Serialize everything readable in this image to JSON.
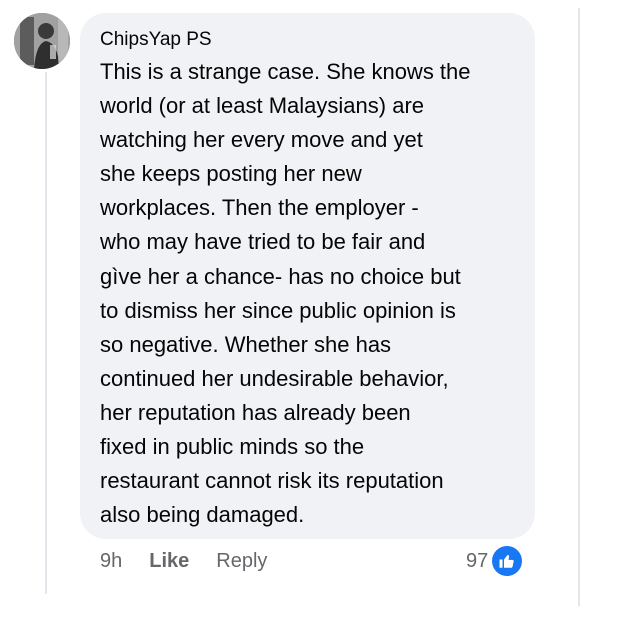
{
  "comment": {
    "author": "ChipsYap PS",
    "lines": [
      "This is a strange case. She knows the",
      "world (or at least Malaysians) are",
      "watching her every move and yet",
      "she keeps posting her new",
      "workplaces. Then the employer -",
      "who may have tried to be fair and",
      "gìve her a chance- has no choice but",
      "to dismiss her since public opinion is",
      "so negative. Whether she has",
      "continued her undesirable behavior,",
      "her reputation has already been",
      "fixed in public minds so the",
      "restaurant cannot risk its reputation",
      "also being damaged."
    ]
  },
  "footer": {
    "time": "9h",
    "like_label": "Like",
    "reply_label": "Reply"
  },
  "reactions": {
    "count": "97",
    "icon": "thumbs-up-icon",
    "color": "#1877f2"
  },
  "colors": {
    "bubble": "#f0f2f5",
    "meta_text": "#65676b",
    "text": "#050505"
  }
}
